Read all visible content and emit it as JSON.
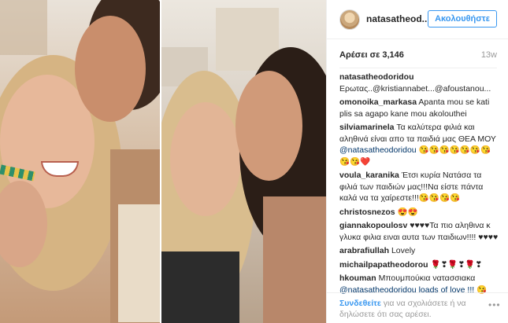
{
  "header": {
    "username": "natasatheod...",
    "follow_label": "Ακολουθήστε"
  },
  "post": {
    "likes": "Αρέσει σε 3,146",
    "time": "13w"
  },
  "comments": [
    {
      "user": "natasatheodoridou",
      "text": "Ερωτας..@kristiannabet...@afoustanou...",
      "mention": ""
    },
    {
      "user": "omonoika_markasa",
      "text": "Apanta mou se kati plis sa agapo kane mou akolouthei",
      "mention": ""
    },
    {
      "user": "silviamarinela",
      "text": "Τα καλύτερα φιλιά και αληθινά είναι απο τα παιδιά μας ΘΕΑ ΜΟΥ",
      "mention": "@natasatheodoridou 😘😘😘😘😘😘😘😘😘❤️"
    },
    {
      "user": "voula_karanika",
      "text": "Έτσι κυρία Νατάσα τα φιλιά των παιδιών μας!!!Να είστε πάντα καλά να τα χαίρεστε!!!😘😘😘😘",
      "mention": ""
    },
    {
      "user": "christosnezos",
      "text": "😍😍",
      "mention": ""
    },
    {
      "user": "giannakopoulosv",
      "text": "♥♥♥♥Τα πιο αληθινα κ γλυκα φιλια ειναι αυτα των παιδιων!!!! ♥♥♥♥",
      "mention": ""
    },
    {
      "user": "arabrafiullah",
      "text": "Lovely",
      "mention": ""
    },
    {
      "user": "michailpapatheodorou",
      "text": "🌹❣🌹❣🌹❣",
      "mention": ""
    },
    {
      "user": "hkouman",
      "text": "Μπουμπούκια νατασσιακα",
      "mention": "@natasatheodoridou loads of love !!! 😘"
    }
  ],
  "footer": {
    "login_link": "Συνδεθείτε",
    "login_text": " για να σχολιάσετε ή να δηλώσετε ότι σας αρέσει.",
    "more_icon": "more-options-icon",
    "more_label": "•••"
  }
}
